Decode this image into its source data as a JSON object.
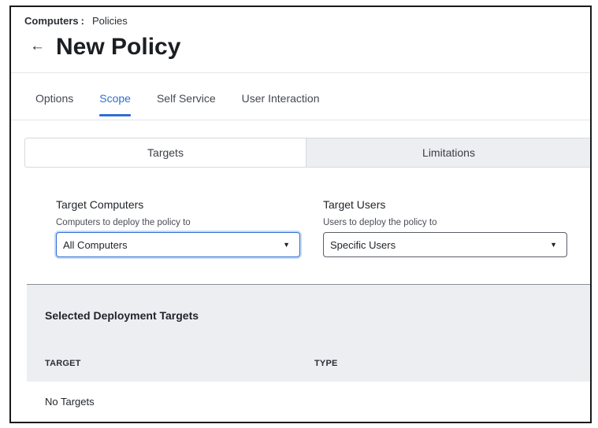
{
  "breadcrumb": {
    "parent": "Computers",
    "separator": ":",
    "current": "Policies"
  },
  "header": {
    "back_icon": "arrow-left-icon",
    "title": "New Policy"
  },
  "tabs": [
    {
      "label": "Options",
      "active": false
    },
    {
      "label": "Scope",
      "active": true
    },
    {
      "label": "Self Service",
      "active": false
    },
    {
      "label": "User Interaction",
      "active": false
    }
  ],
  "segmented": {
    "targets": "Targets",
    "limitations": "Limitations",
    "selected": "Targets"
  },
  "target_computers": {
    "label": "Target Computers",
    "help": "Computers to deploy the policy to",
    "value": "All Computers"
  },
  "target_users": {
    "label": "Target Users",
    "help": "Users to deploy the policy to",
    "value": "Specific Users"
  },
  "deployment": {
    "title": "Selected Deployment Targets",
    "columns": [
      "TARGET",
      "TYPE"
    ],
    "empty_text": "No Targets"
  },
  "colors": {
    "accent": "#2f6fd2",
    "panel_bg": "#eceef1",
    "text": "#1f2329"
  }
}
